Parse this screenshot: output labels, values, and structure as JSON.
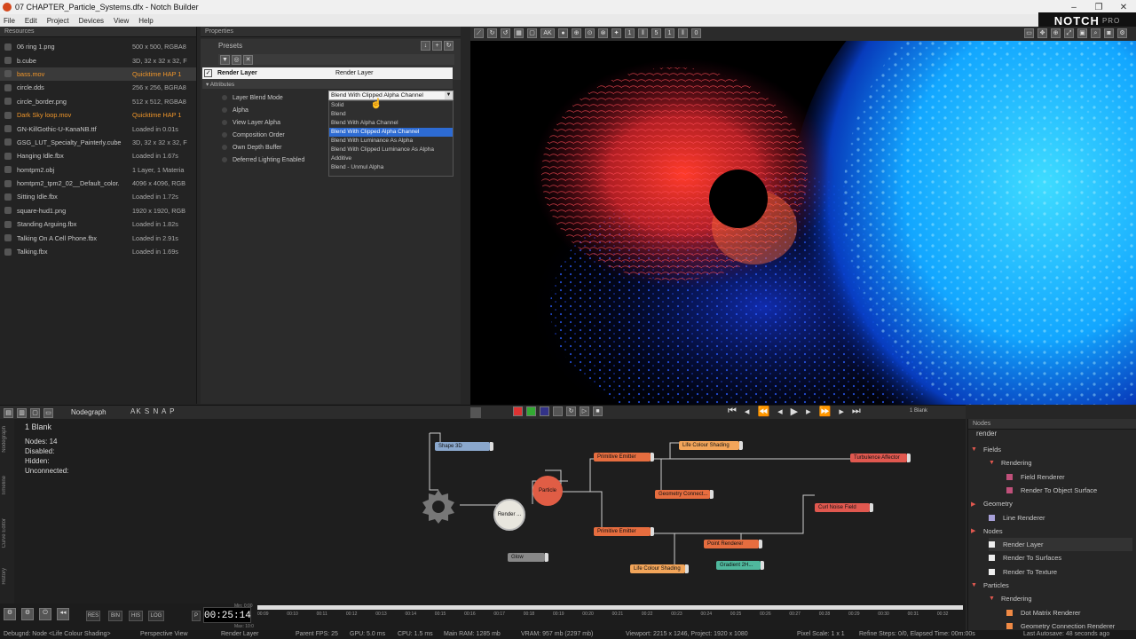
{
  "title": {
    "text": "07 CHAPTER_Particle_Systems.dfx - Notch Builder"
  },
  "menu": [
    "File",
    "Edit",
    "Project",
    "Devices",
    "View",
    "Help"
  ],
  "logo": {
    "text": "NOTCH",
    "sub": "PRO"
  },
  "resources": {
    "header": "Resources",
    "items": [
      {
        "name": "06 ring 1.png",
        "info": "500 x 500, RGBA8",
        "style": ""
      },
      {
        "name": "b.cube",
        "info": "3D, 32 x 32 x 32, F",
        "style": ""
      },
      {
        "name": "bass.mov",
        "info": "Quicktime HAP 1",
        "style": "sel or"
      },
      {
        "name": "circle.dds",
        "info": "256 x 256, BGRA8",
        "style": ""
      },
      {
        "name": "circle_border.png",
        "info": "512 x 512, RGBA8",
        "style": ""
      },
      {
        "name": "Dark Sky loop.mov",
        "info": "Quicktime HAP 1",
        "style": "or"
      },
      {
        "name": "GN-KillGothic-U-KanaNB.ttf",
        "info": "Loaded in 0.01s",
        "style": ""
      },
      {
        "name": "GSG_LUT_Specialty_Painterly.cube",
        "info": "3D, 32 x 32 x 32, F",
        "style": ""
      },
      {
        "name": "Hanging Idle.fbx",
        "info": "Loaded in 1.67s",
        "style": ""
      },
      {
        "name": "homtpm2.obj",
        "info": "1 Layer, 1 Materia",
        "style": ""
      },
      {
        "name": "homtpm2_tpm2_02__Default_color.",
        "info": "4096 x 4096, RGB",
        "style": ""
      },
      {
        "name": "Sitting Idle.fbx",
        "info": "Loaded in 1.72s",
        "style": ""
      },
      {
        "name": "square-hud1.png",
        "info": "1920 x 1920, RGB",
        "style": ""
      },
      {
        "name": "Standing Arguing.fbx",
        "info": "Loaded in 1.82s",
        "style": ""
      },
      {
        "name": "Talking On A Cell Phone.fbx",
        "info": "Loaded in 2.91s",
        "style": ""
      },
      {
        "name": "Talking.fbx",
        "info": "Loaded in 1.69s",
        "style": ""
      }
    ]
  },
  "properties": {
    "header": "Properties",
    "presets": "Presets",
    "layer_label": "Render Layer",
    "layer_value": "Render Layer",
    "attributes": "Attributes",
    "rows": [
      "Layer Blend Mode",
      "Alpha",
      "View Layer Alpha",
      "Composition Order",
      "Own Depth Buffer",
      "Deferred Lighting Enabled"
    ],
    "blend_value": "Blend With Clipped Alpha Channel",
    "blend_options": [
      "Solid",
      "Blend",
      "Blend With Alpha Channel",
      "Blend With Clipped Alpha Channel",
      "Blend With Luminance As Alpha",
      "Blend With Clipped Luminance As Alpha",
      "Additive",
      "Blend - Unmul Alpha"
    ],
    "blend_highlight": 3
  },
  "viewport_toolbar": {
    "n1": "1",
    "n2": "5",
    "n3": "1",
    "n4": "0",
    "ak": "AK"
  },
  "nodegraph": {
    "tab": "Nodegraph",
    "toolbar": "AK S N A P",
    "layer": "1  Blank",
    "stats": [
      "Nodes:  14",
      "Disabled:",
      "Hidden:",
      "Unconnected:"
    ],
    "nodes": [
      "Shape 3D",
      "Primitive Emitter",
      "Life Colour Shading",
      "Turbulence Affector",
      "Particle",
      "Geometry Connect...",
      "Render ...",
      "Curl Noise Field",
      "Primitive Emitter",
      "Point Renderer",
      "Life Colour Shading",
      "Gradient 2H...",
      "Glow"
    ],
    "side_tabs": [
      "Nodegraph",
      "Timeline",
      "Curve Editor",
      "History"
    ]
  },
  "transport": {
    "layer": "1 Blank"
  },
  "nodes_panel": {
    "header": "Nodes",
    "search": "render",
    "items": [
      {
        "label": "Fields",
        "type": "cat",
        "indent": 0,
        "color": ""
      },
      {
        "label": "Rendering",
        "type": "sub",
        "indent": 1,
        "color": ""
      },
      {
        "label": "Field Renderer",
        "type": "item",
        "indent": 2,
        "color": "#c0507a"
      },
      {
        "label": "Render To Object Surface",
        "type": "item",
        "indent": 2,
        "color": "#c0507a"
      },
      {
        "label": "Geometry",
        "type": "cat",
        "indent": 0,
        "color": ""
      },
      {
        "label": "Line Renderer",
        "type": "item",
        "indent": 1,
        "color": "#a7a0d8"
      },
      {
        "label": "Nodes",
        "type": "cat",
        "indent": 0,
        "color": ""
      },
      {
        "label": "Render Layer",
        "type": "item",
        "indent": 1,
        "color": "#eeeeee"
      },
      {
        "label": "Render To Surfaces",
        "type": "item",
        "indent": 1,
        "color": "#eeeeee"
      },
      {
        "label": "Render To Texture",
        "type": "item",
        "indent": 1,
        "color": "#eeeeee"
      },
      {
        "label": "Particles",
        "type": "cat",
        "indent": 0,
        "color": ""
      },
      {
        "label": "Rendering",
        "type": "sub",
        "indent": 1,
        "color": ""
      },
      {
        "label": "Dot Matrix Renderer",
        "type": "item",
        "indent": 2,
        "color": "#f08a45"
      },
      {
        "label": "Geometry Connection Renderer",
        "type": "item",
        "indent": 2,
        "color": "#f08a45"
      }
    ]
  },
  "timeline": {
    "timecode": "00:25:14",
    "buttons": [
      "RES",
      "BIN",
      "HIS",
      "LOG"
    ],
    "minlabel": "Min: 0:00",
    "maxlabel": "Max: 10:0",
    "ticks": [
      "00:09",
      "00:10",
      "00:11",
      "00:12",
      "00:13",
      "00:14",
      "00:15",
      "00:16",
      "00:17",
      "00:18",
      "00:19",
      "00:20",
      "00:21",
      "00:22",
      "00:23",
      "00:24",
      "00:25",
      "00:26",
      "00:27",
      "00:28",
      "00:29",
      "00:30",
      "00:31",
      "00:32"
    ]
  },
  "status": {
    "debug": "Debugnd: Node <Life Colour Shading>",
    "view": "Perspective View",
    "layer": "Render Layer",
    "fps": "Parent FPS: 25",
    "gpu": "GPU: 5.0 ms",
    "cpu": "CPU: 1.5 ms",
    "ram": "Main RAM: 1285 mb",
    "vram": "VRAM: 957 mb (2297 mb)",
    "vp": "Viewport: 2215 x 1246, Project: 1920 x 1080",
    "scale": "Pixel Scale: 1 x 1",
    "refine": "Refine Steps: 0/0, Elapsed Time: 00m:00s",
    "autosave": "Last Autosave: 48 seconds ago"
  },
  "colors": {
    "accent": "#2d6bd3",
    "node_orange": "#e66d3f",
    "render_red": "#e0584f"
  }
}
